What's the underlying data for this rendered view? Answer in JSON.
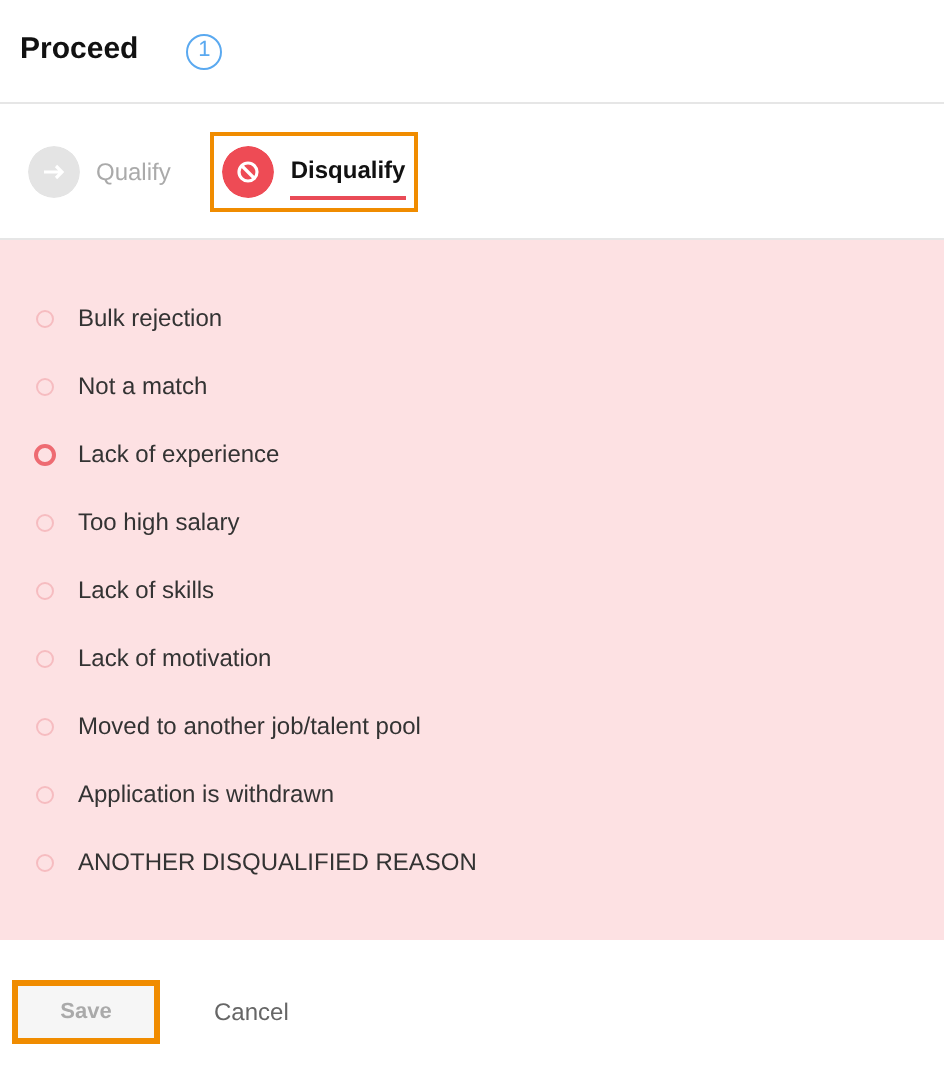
{
  "title": "Proceed",
  "step": "1",
  "tabs": [
    {
      "label": "Qualify",
      "selected": false,
      "outlined": false
    },
    {
      "label": "Disqualify",
      "selected": true,
      "outlined": true
    }
  ],
  "reasons": [
    {
      "label": "Bulk rejection",
      "selected": false
    },
    {
      "label": "Not a match",
      "selected": false
    },
    {
      "label": "Lack of experience",
      "selected": true
    },
    {
      "label": "Too high salary",
      "selected": false
    },
    {
      "label": "Lack of skills",
      "selected": false
    },
    {
      "label": "Lack of motivation",
      "selected": false
    },
    {
      "label": "Moved to another job/talent pool",
      "selected": false
    },
    {
      "label": "Application is withdrawn",
      "selected": false
    },
    {
      "label": "ANOTHER DISQUALIFIED REASON",
      "selected": false
    }
  ],
  "buttons": [
    {
      "label": "Save",
      "kind": "primary",
      "disabled": true,
      "outlined": true
    },
    {
      "label": "Cancel",
      "kind": "link",
      "disabled": false,
      "outlined": false
    }
  ]
}
